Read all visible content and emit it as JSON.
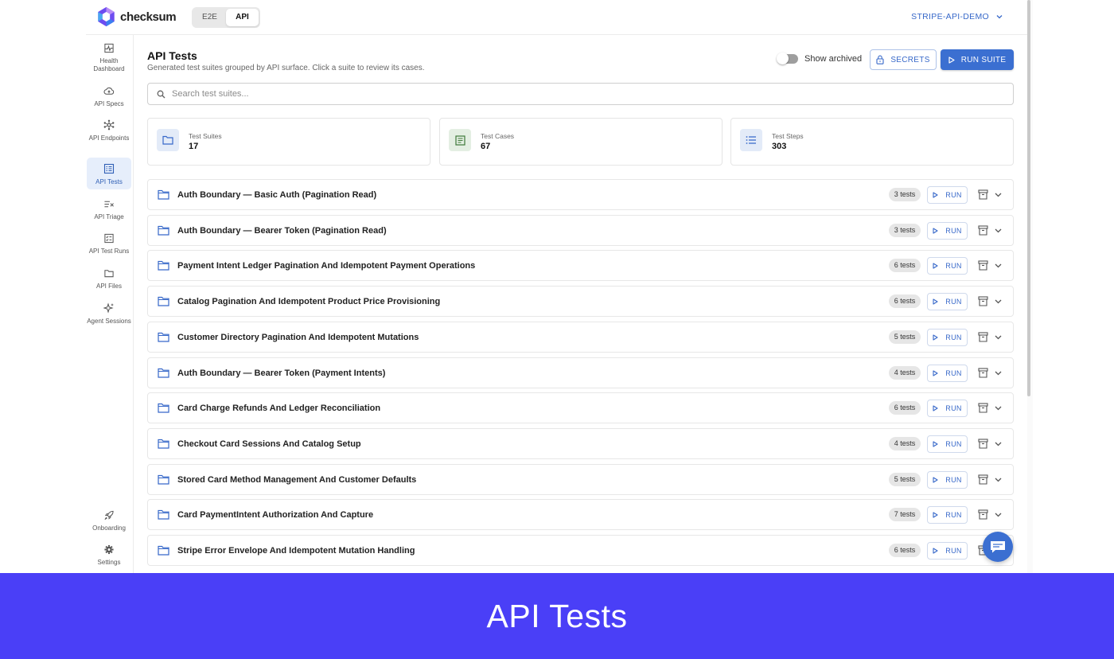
{
  "brand": {
    "name": "checksum"
  },
  "mode_tabs": [
    {
      "label": "E2E",
      "active": false
    },
    {
      "label": "API",
      "active": true
    }
  ],
  "project": {
    "name": "STRIPE-API-DEMO"
  },
  "sidebar": {
    "items": [
      {
        "label": "Health Dashboard",
        "icon": "pulse-chart-icon"
      },
      {
        "label": "API Specs",
        "icon": "cloud-upload-icon"
      },
      {
        "label": "API Endpoints",
        "icon": "network-nodes-icon"
      },
      {
        "label": "API Tests",
        "icon": "list-table-icon",
        "active": true
      },
      {
        "label": "API Triage",
        "icon": "list-x-icon"
      },
      {
        "label": "API Test Runs",
        "icon": "checklist-icon"
      },
      {
        "label": "API Files",
        "icon": "folder-icon"
      },
      {
        "label": "Agent Sessions",
        "icon": "sparkles-icon"
      }
    ],
    "bottom_items": [
      {
        "label": "Onboarding",
        "icon": "rocket-icon"
      },
      {
        "label": "Settings",
        "icon": "gear-icon"
      }
    ]
  },
  "page": {
    "title": "API Tests",
    "subtitle": "Generated test suites grouped by API surface. Click a suite to review its cases.",
    "show_archived_label": "Show archived",
    "secrets_label": "SECRETS",
    "run_suite_label": "RUN SUITE",
    "search_placeholder": "Search test suites..."
  },
  "stats": [
    {
      "label": "Test Suites",
      "value": "17"
    },
    {
      "label": "Test Cases",
      "value": "67"
    },
    {
      "label": "Test Steps",
      "value": "303"
    }
  ],
  "suites": [
    {
      "name": "Auth Boundary — Basic Auth (Pagination Read)",
      "count": "3 tests"
    },
    {
      "name": "Auth Boundary — Bearer Token (Pagination Read)",
      "count": "3 tests"
    },
    {
      "name": "Payment Intent Ledger Pagination And Idempotent Payment Operations",
      "count": "6 tests"
    },
    {
      "name": "Catalog Pagination And Idempotent Product Price Provisioning",
      "count": "6 tests"
    },
    {
      "name": "Customer Directory Pagination And Idempotent Mutations",
      "count": "5 tests"
    },
    {
      "name": "Auth Boundary — Bearer Token (Payment Intents)",
      "count": "4 tests"
    },
    {
      "name": "Card Charge Refunds And Ledger Reconciliation",
      "count": "6 tests"
    },
    {
      "name": "Checkout Card Sessions And Catalog Setup",
      "count": "4 tests"
    },
    {
      "name": "Stored Card Method Management And Customer Defaults",
      "count": "5 tests"
    },
    {
      "name": "Card PaymentIntent Authorization And Capture",
      "count": "7 tests"
    },
    {
      "name": "Stripe Error Envelope And Idempotent Mutation Handling",
      "count": "6 tests"
    }
  ],
  "run_label": "RUN",
  "banner": {
    "text": "API Tests"
  },
  "colors": {
    "accent": "#3b6fd1",
    "banner": "#4a3ff7"
  }
}
